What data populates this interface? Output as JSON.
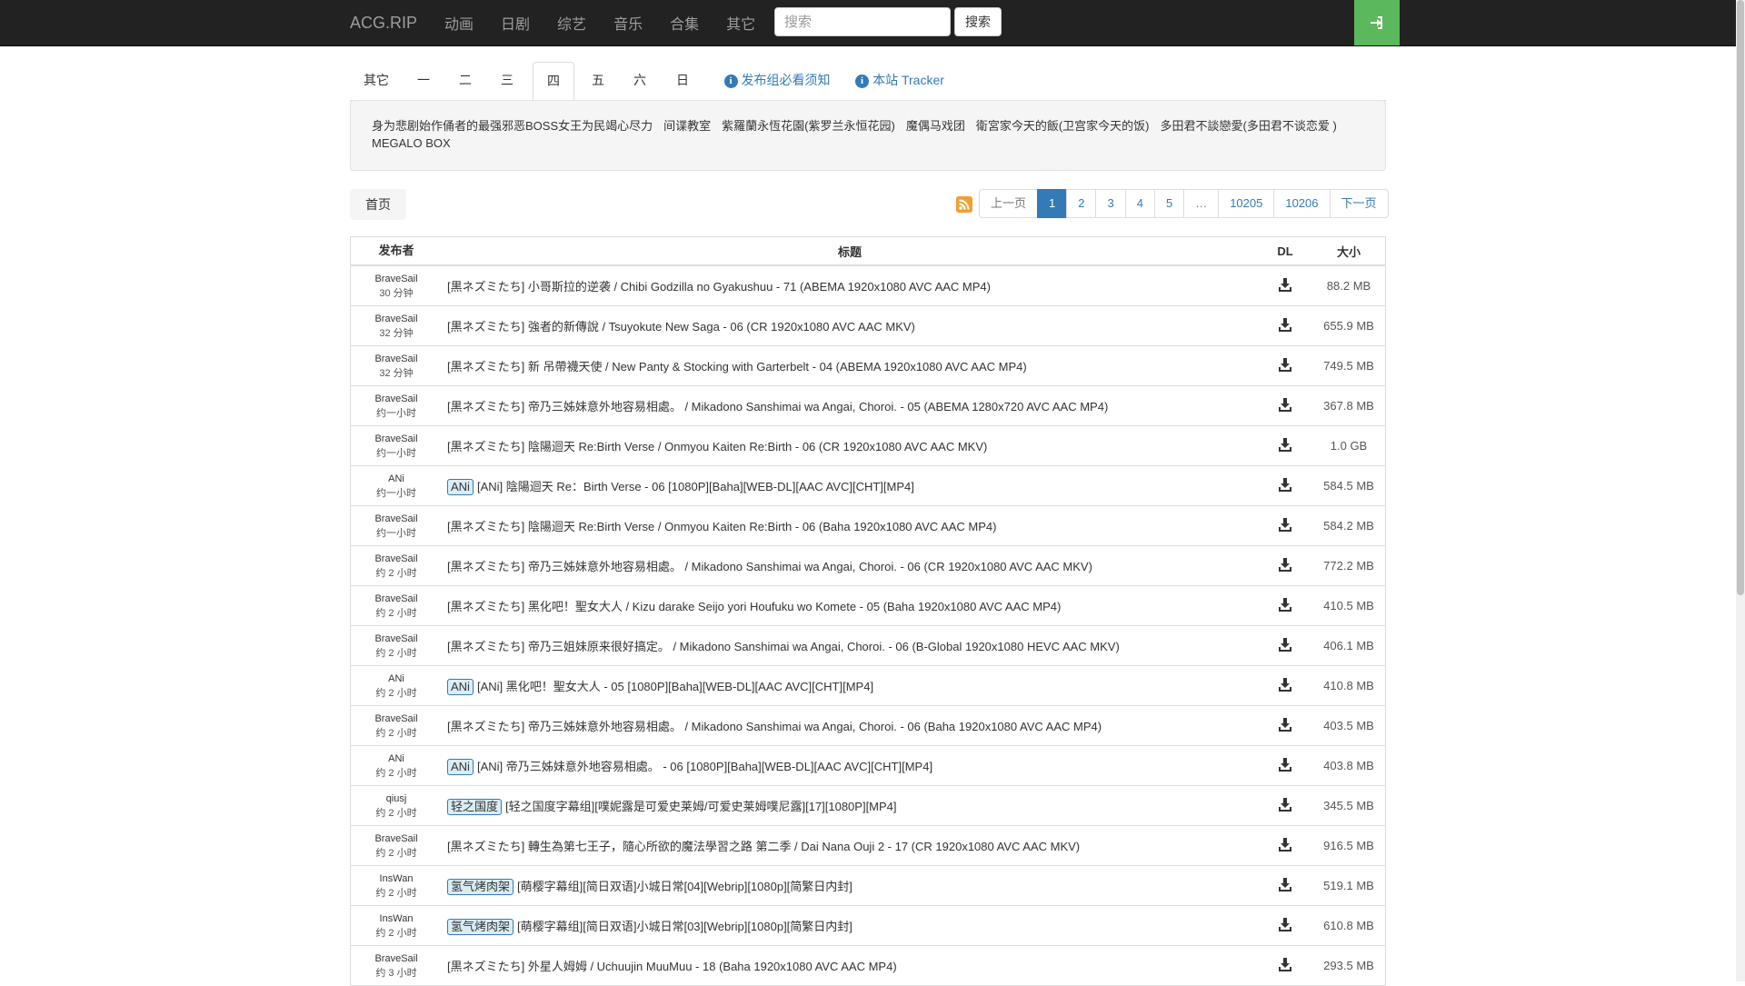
{
  "nav": {
    "brand": "ACG.RIP",
    "links": [
      "动画",
      "日剧",
      "综艺",
      "音乐",
      "合集",
      "其它"
    ],
    "search_placeholder": "搜索",
    "search_button": "搜索",
    "login_icon": "sign-in-icon",
    "login_color": "#5cb85c"
  },
  "tabs": {
    "items": [
      "其它",
      "一",
      "二",
      "三",
      "四",
      "五",
      "六",
      "日"
    ],
    "active": "四",
    "links": [
      "发布组必看须知",
      "本站 Tracker"
    ]
  },
  "schedule": [
    "身为悲剧始作俑者的最强邪恶BOSS女王为民竭心尽力",
    "间谍教室",
    "紫羅蘭永恆花園(紫罗兰永恒花园)",
    "魔偶马戏团",
    "衛宮家今天的飯(卫宫家今天的饭)",
    "多田君不談戀愛(多田君不谈恋爱 )",
    "MEGALO BOX"
  ],
  "breadcrumb": "首页",
  "pagination": [
    "上一页",
    "1",
    "2",
    "3",
    "4",
    "5",
    "…",
    "10205",
    "10206",
    "下一页"
  ],
  "table": {
    "headers": [
      "发布者",
      "标题",
      "DL",
      "大小"
    ],
    "rows": [
      {
        "publisher": "BraveSail",
        "time": "30 分钟",
        "tag": "",
        "title": "[黒ネズミたち] 小哥斯拉的逆袭 / Chibi Godzilla no Gyakushuu - 71 (ABEMA 1920x1080 AVC AAC MP4)",
        "size": "88.2 MB"
      },
      {
        "publisher": "BraveSail",
        "time": "32 分钟",
        "tag": "",
        "title": "[黒ネズミたち] 強者的新傳說 / Tsuyokute New Saga - 06 (CR 1920x1080 AVC AAC MKV)",
        "size": "655.9 MB"
      },
      {
        "publisher": "BraveSail",
        "time": "32 分钟",
        "tag": "",
        "title": "[黒ネズミたち] 新 吊帶襪天使 / New Panty & Stocking with Garterbelt - 04 (ABEMA 1920x1080 AVC AAC MP4)",
        "size": "749.5 MB"
      },
      {
        "publisher": "BraveSail",
        "time": "约一小时",
        "tag": "",
        "title": "[黒ネズミたち] 帝乃三姊妹意外地容易相處。 / Mikadono Sanshimai wa Angai, Choroi. - 05 (ABEMA 1280x720 AVC AAC MP4)",
        "size": "367.8 MB"
      },
      {
        "publisher": "BraveSail",
        "time": "约一小时",
        "tag": "",
        "title": "[黒ネズミたち] 陰陽迴天 Re:Birth Verse / Onmyou Kaiten Re:Birth - 06 (CR 1920x1080 AVC AAC MKV)",
        "size": "1.0 GB"
      },
      {
        "publisher": "ANi",
        "time": "约一小时",
        "tag": "ANi",
        "title": "[ANi] 陰陽迴天 Re：Birth Verse - 06 [1080P][Baha][WEB-DL][AAC AVC][CHT][MP4]",
        "size": "584.5 MB"
      },
      {
        "publisher": "BraveSail",
        "time": "约一小时",
        "tag": "",
        "title": "[黒ネズミたち] 陰陽迴天 Re:Birth Verse / Onmyou Kaiten Re:Birth - 06 (Baha 1920x1080 AVC AAC MP4)",
        "size": "584.2 MB"
      },
      {
        "publisher": "BraveSail",
        "time": "约 2 小时",
        "tag": "",
        "title": "[黒ネズミたち] 帝乃三姊妹意外地容易相處。 / Mikadono Sanshimai wa Angai, Choroi. - 06 (CR 1920x1080 AVC AAC MKV)",
        "size": "772.2 MB"
      },
      {
        "publisher": "BraveSail",
        "time": "约 2 小时",
        "tag": "",
        "title": "[黒ネズミたち] 黑化吧！聖女大人 / Kizu darake Seijo yori Houfuku wo Komete - 05 (Baha 1920x1080 AVC AAC MP4)",
        "size": "410.5 MB"
      },
      {
        "publisher": "BraveSail",
        "time": "约 2 小时",
        "tag": "",
        "title": "[黒ネズミたち] 帝乃三姐妹原来很好搞定。 / Mikadono Sanshimai wa Angai, Choroi. - 06 (B-Global 1920x1080 HEVC AAC MKV)",
        "size": "406.1 MB"
      },
      {
        "publisher": "ANi",
        "time": "约 2 小时",
        "tag": "ANi",
        "title": "[ANi] 黑化吧！聖女大人 - 05 [1080P][Baha][WEB-DL][AAC AVC][CHT][MP4]",
        "size": "410.8 MB"
      },
      {
        "publisher": "BraveSail",
        "time": "约 2 小时",
        "tag": "",
        "title": "[黒ネズミたち] 帝乃三姊妹意外地容易相處。 / Mikadono Sanshimai wa Angai, Choroi. - 06 (Baha 1920x1080 AVC AAC MP4)",
        "size": "403.5 MB"
      },
      {
        "publisher": "ANi",
        "time": "约 2 小时",
        "tag": "ANi",
        "title": "[ANi] 帝乃三姊妹意外地容易相處。 - 06 [1080P][Baha][WEB-DL][AAC AVC][CHT][MP4]",
        "size": "403.8 MB"
      },
      {
        "publisher": "qiusj",
        "time": "约 2 小时",
        "tag": "轻之国度",
        "title": "[轻之国度字幕组][噗妮露是可爱史莱姆/可爱史莱姆噗尼露][17][1080P][MP4]",
        "size": "345.5 MB"
      },
      {
        "publisher": "BraveSail",
        "time": "约 2 小时",
        "tag": "",
        "title": "[黒ネズミたち] 轉生為第七王子，隨心所欲的魔法學習之路 第二季 / Dai Nana Ouji 2 - 17 (CR 1920x1080 AVC AAC MKV)",
        "size": "916.5 MB"
      },
      {
        "publisher": "InsWan",
        "time": "约 2 小时",
        "tag": "氢气烤肉架",
        "title": "[萌樱字幕组][简日双语]小城日常[04][Webrip][1080p][简繁日内封]",
        "size": "519.1 MB"
      },
      {
        "publisher": "InsWan",
        "time": "约 2 小时",
        "tag": "氢气烤肉架",
        "title": "[萌樱字幕组][简日双语]小城日常[03][Webrip][1080p][简繁日内封]",
        "size": "610.8 MB"
      },
      {
        "publisher": "BraveSail",
        "time": "约 3 小时",
        "tag": "",
        "title": "[黒ネズミたち] 外星人姆姆 / Uchuujin MuuMuu - 18 (Baha 1920x1080 AVC AAC MP4)",
        "size": "293.5 MB"
      }
    ]
  },
  "icons": {
    "rss": "rss-icon",
    "download": "download-icon",
    "info": "info-icon"
  },
  "colors": {
    "navbar": "#222222",
    "link": "#337ab7",
    "active_page": "#337ab7",
    "rss": "#f0a030"
  }
}
